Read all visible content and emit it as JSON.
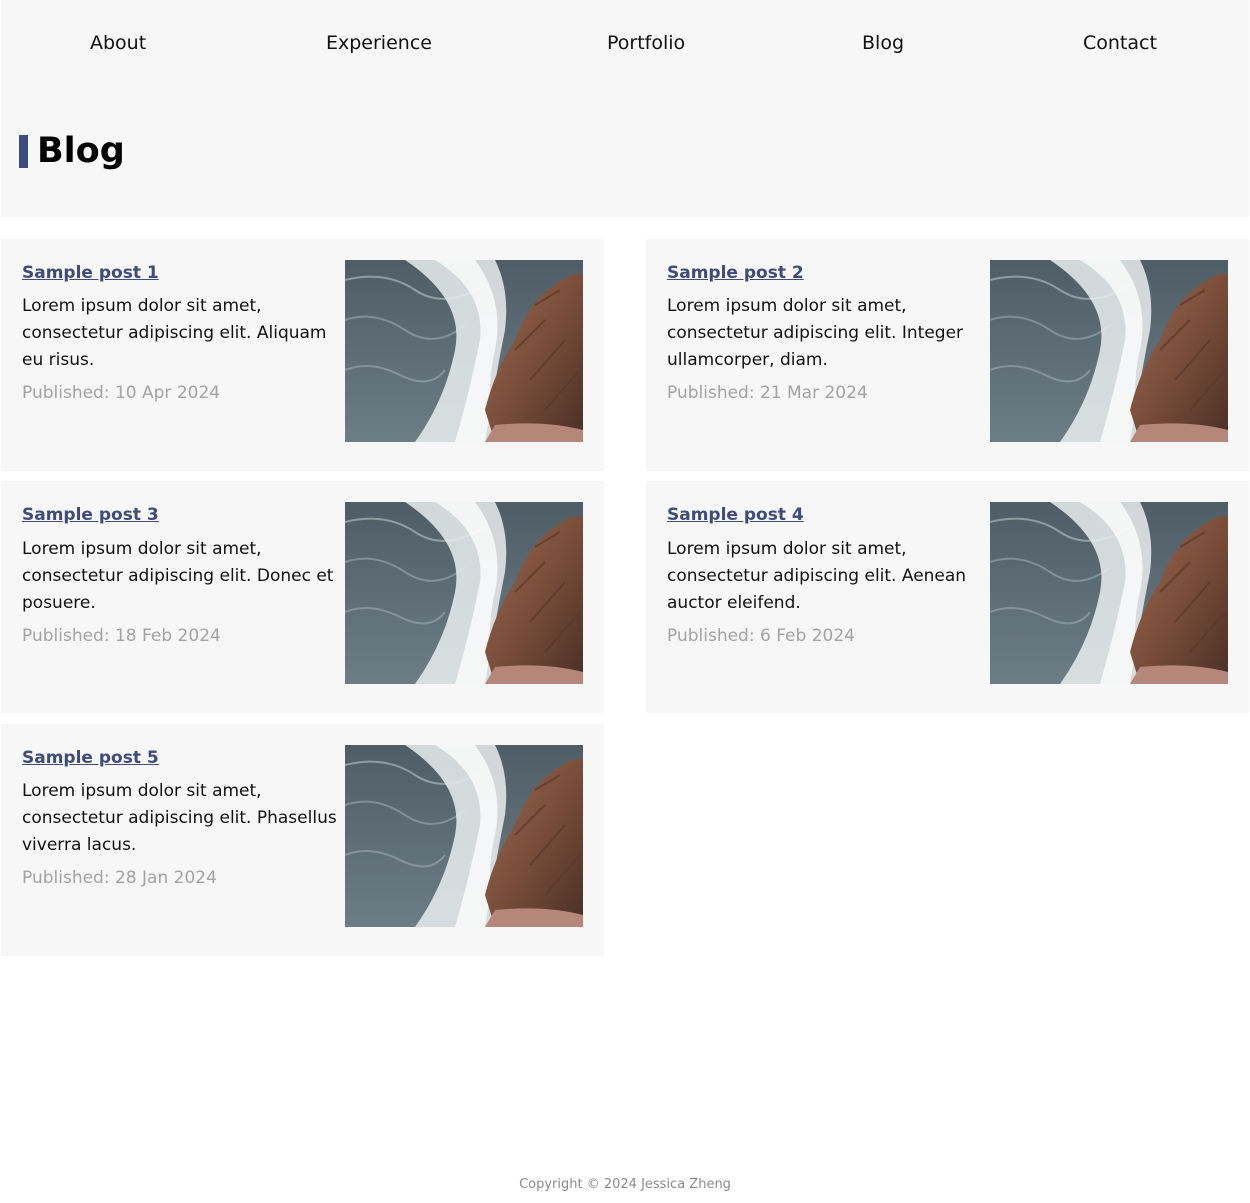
{
  "nav": {
    "items": [
      {
        "label": "About"
      },
      {
        "label": "Experience"
      },
      {
        "label": "Portfolio"
      },
      {
        "label": "Blog"
      },
      {
        "label": "Contact"
      }
    ]
  },
  "page": {
    "title": "Blog",
    "accent_color": "#3f4b7a"
  },
  "posts": [
    {
      "title": "Sample post 1",
      "description": "Lorem ipsum dolor sit amet, consectetur adipiscing elit. Aliquam eu risus.",
      "date": "Published: 10 Apr 2024",
      "image": "ocean-waves-rocks-photo"
    },
    {
      "title": "Sample post 2",
      "description": "Lorem ipsum dolor sit amet, consectetur adipiscing elit. Integer ullamcorper, diam.",
      "date": "Published: 21 Mar 2024",
      "image": "ocean-waves-rocks-photo"
    },
    {
      "title": "Sample post 3",
      "description": "Lorem ipsum dolor sit amet, consectetur adipiscing elit. Donec et posuere.",
      "date": "Published: 18 Feb 2024",
      "image": "ocean-waves-rocks-photo"
    },
    {
      "title": "Sample post 4",
      "description": "Lorem ipsum dolor sit amet, consectetur adipiscing elit. Aenean auctor eleifend.",
      "date": "Published: 6 Feb 2024",
      "image": "ocean-waves-rocks-photo"
    },
    {
      "title": "Sample post 5",
      "description": "Lorem ipsum dolor sit amet, consectetur adipiscing elit. Phasellus viverra lacus.",
      "date": "Published: 28 Jan 2024",
      "image": "ocean-waves-rocks-photo"
    }
  ],
  "footer": {
    "copyright": "Copyright © 2024 Jessica Zheng"
  }
}
